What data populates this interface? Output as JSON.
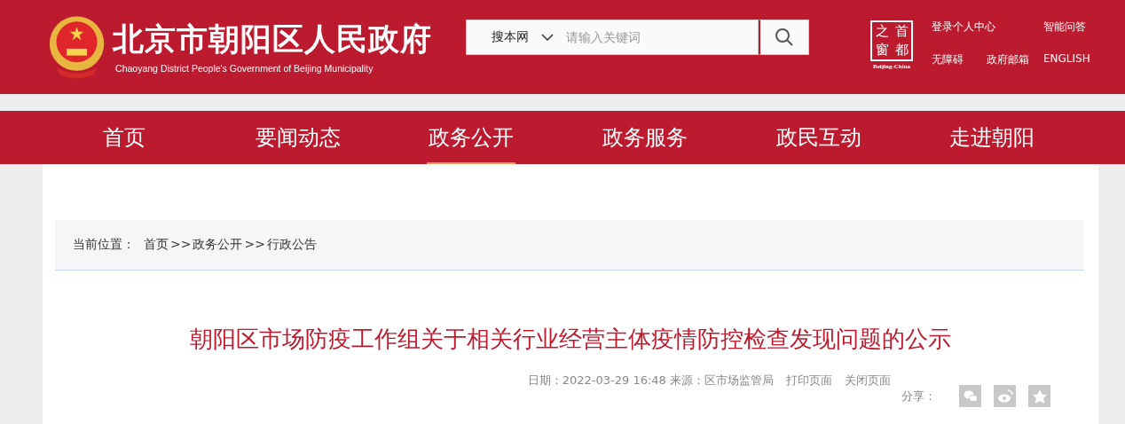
{
  "header": {
    "title": "北京市朝阳区人民政府",
    "subtitle": "Chaoyang District People's Government of Beijing Municipality",
    "search": {
      "scope": "搜本网",
      "placeholder": "请输入关键词"
    },
    "portal_logo": {
      "chars": [
        "之",
        "首",
        "窗",
        "都"
      ],
      "caption": "Beijing-China"
    },
    "links": [
      "登录个人中心",
      "智能问答",
      "无障碍",
      "政府邮箱",
      "ENGLISH"
    ]
  },
  "nav": [
    {
      "label": "首页",
      "selected": false
    },
    {
      "label": "要闻动态",
      "selected": false
    },
    {
      "label": "政务公开",
      "selected": true
    },
    {
      "label": "政务服务",
      "selected": false
    },
    {
      "label": "政民互动",
      "selected": false
    },
    {
      "label": "走进朝阳",
      "selected": false
    }
  ],
  "breadcrumb": {
    "label": "当前位置：",
    "items": [
      "首页",
      ">>",
      "政务公开",
      ">>",
      "行政公告"
    ]
  },
  "article": {
    "title": "朝阳区市场防疫工作组关于相关行业经营主体疫情防控检查发现问题的公示",
    "meta": "日期：2022-03-29 16:48 来源：区市场监管局",
    "actions": [
      "打印页面",
      "关闭页面"
    ],
    "share_label": "分享：",
    "share": [
      {
        "kind": "wechat"
      },
      {
        "kind": "weibo"
      },
      {
        "kind": "qzone"
      }
    ]
  }
}
